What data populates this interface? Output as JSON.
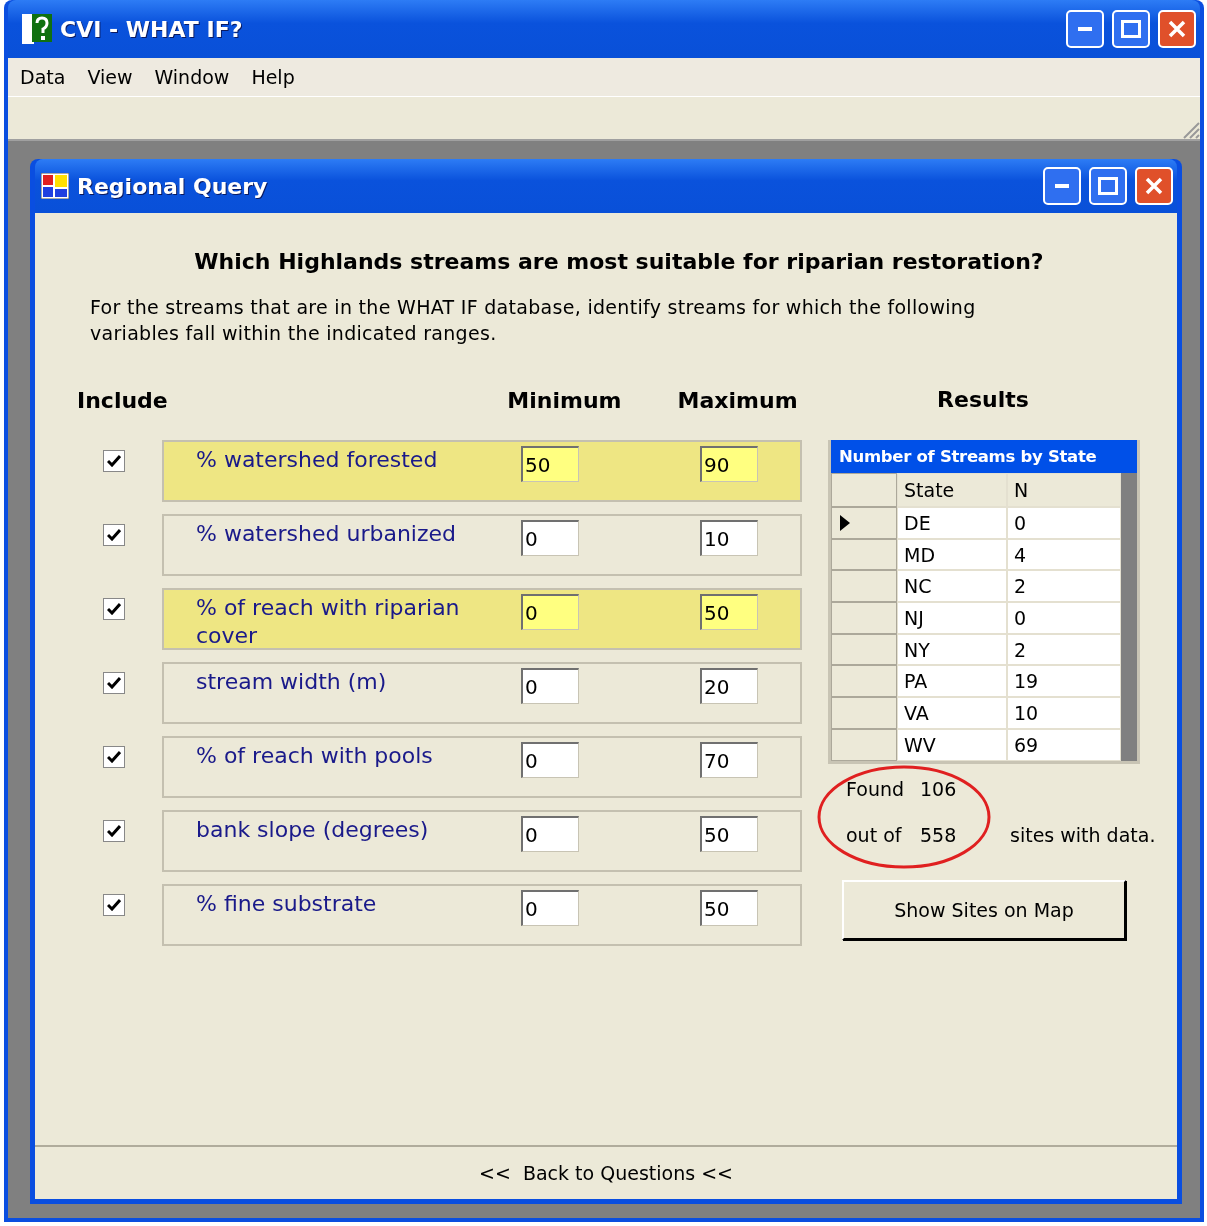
{
  "window": {
    "title": "CVI - WHAT IF?"
  },
  "menu": [
    "Data",
    "View",
    "Window",
    "Help"
  ],
  "child_window": {
    "title": "Regional Query"
  },
  "question": "Which Highlands streams are most suitable for riparian restoration?",
  "description": "For the streams that are in the WHAT IF database, identify streams for which the following variables fall within the indicated ranges.",
  "headers": {
    "include": "Include",
    "minimum": "Minimum",
    "maximum": "Maximum",
    "results": "Results"
  },
  "variables": [
    {
      "label": "% watershed forested",
      "checked": true,
      "highlighted": true,
      "minimum": "50",
      "maximum": "90"
    },
    {
      "label": "% watershed urbanized",
      "checked": true,
      "highlighted": false,
      "minimum": "0",
      "maximum": "10"
    },
    {
      "label": "% of reach with riparian cover",
      "checked": true,
      "highlighted": true,
      "minimum": "0",
      "maximum": "50"
    },
    {
      "label": "stream width (m)",
      "checked": true,
      "highlighted": false,
      "minimum": "0",
      "maximum": "20"
    },
    {
      "label": "% of reach with pools",
      "checked": true,
      "highlighted": false,
      "minimum": "0",
      "maximum": "70"
    },
    {
      "label": "bank slope (degrees)",
      "checked": true,
      "highlighted": false,
      "minimum": "0",
      "maximum": "50"
    },
    {
      "label": "% fine substrate",
      "checked": true,
      "highlighted": false,
      "minimum": "0",
      "maximum": "50"
    }
  ],
  "results": {
    "title": "Number of Streams by State",
    "columns": [
      "State",
      "N"
    ],
    "rows": [
      {
        "state": "DE",
        "n": "0",
        "selected": true
      },
      {
        "state": "MD",
        "n": "4",
        "selected": false
      },
      {
        "state": "NC",
        "n": "2",
        "selected": false
      },
      {
        "state": "NJ",
        "n": "0",
        "selected": false
      },
      {
        "state": "NY",
        "n": "2",
        "selected": false
      },
      {
        "state": "PA",
        "n": "19",
        "selected": false
      },
      {
        "state": "VA",
        "n": "10",
        "selected": false
      },
      {
        "state": "WV",
        "n": "69",
        "selected": false
      }
    ],
    "found_label": "Found",
    "found": "106",
    "out_of_label": "out of",
    "total": "558",
    "suffix": "sites with data.",
    "button": "Show Sites on Map"
  },
  "footer_button": "<<  Back to Questions <<"
}
